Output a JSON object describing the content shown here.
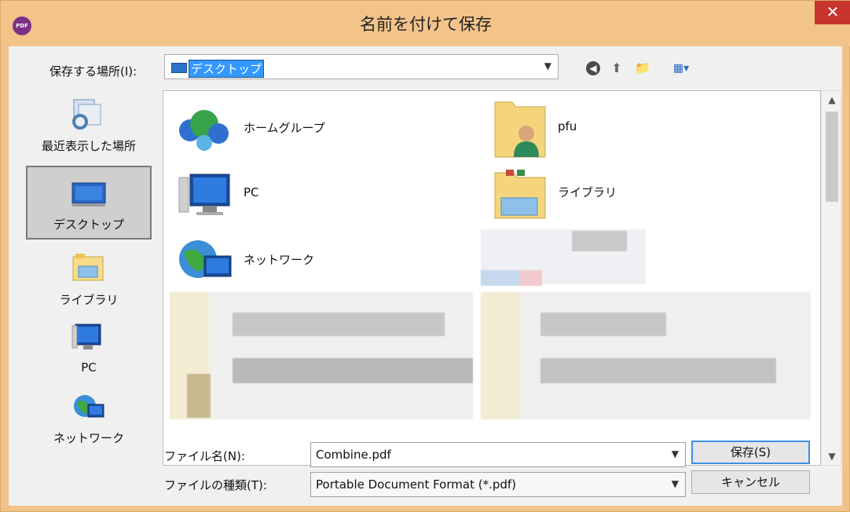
{
  "window": {
    "title": "名前を付けて保存",
    "app_icon_label": "PDF",
    "close_glyph": "✕"
  },
  "location": {
    "label": "保存する場所(I):",
    "value": "デスクトップ"
  },
  "toolbar": {
    "back_icon": "back-icon",
    "up_icon": "up-folder-icon",
    "new_folder_icon": "new-folder-icon",
    "view_menu_icon": "view-menu-icon"
  },
  "places": [
    {
      "label": "最近表示した場所",
      "icon": "recent-places-icon"
    },
    {
      "label": "デスクトップ",
      "icon": "desktop-icon",
      "selected": true
    },
    {
      "label": "ライブラリ",
      "icon": "libraries-icon"
    },
    {
      "label": "PC",
      "icon": "pc-icon"
    },
    {
      "label": "ネットワーク",
      "icon": "network-icon"
    }
  ],
  "files": [
    {
      "label": "ホームグループ",
      "icon": "homegroup-icon"
    },
    {
      "label": "pfu",
      "icon": "user-folder-icon"
    },
    {
      "label": "PC",
      "icon": "pc-icon"
    },
    {
      "label": "ライブラリ",
      "icon": "libraries-icon"
    },
    {
      "label": "ネットワーク",
      "icon": "network-icon"
    }
  ],
  "file_name": {
    "label": "ファイル名(N):",
    "value": "Combine.pdf"
  },
  "file_type": {
    "label": "ファイルの種類(T):",
    "value": "Portable Document Format (*.pdf)"
  },
  "buttons": {
    "save": "保存(S)",
    "cancel": "キャンセル"
  },
  "colors": {
    "accent": "#3c8ee8",
    "titlebar": "#f3c48a",
    "close": "#c7352c"
  }
}
